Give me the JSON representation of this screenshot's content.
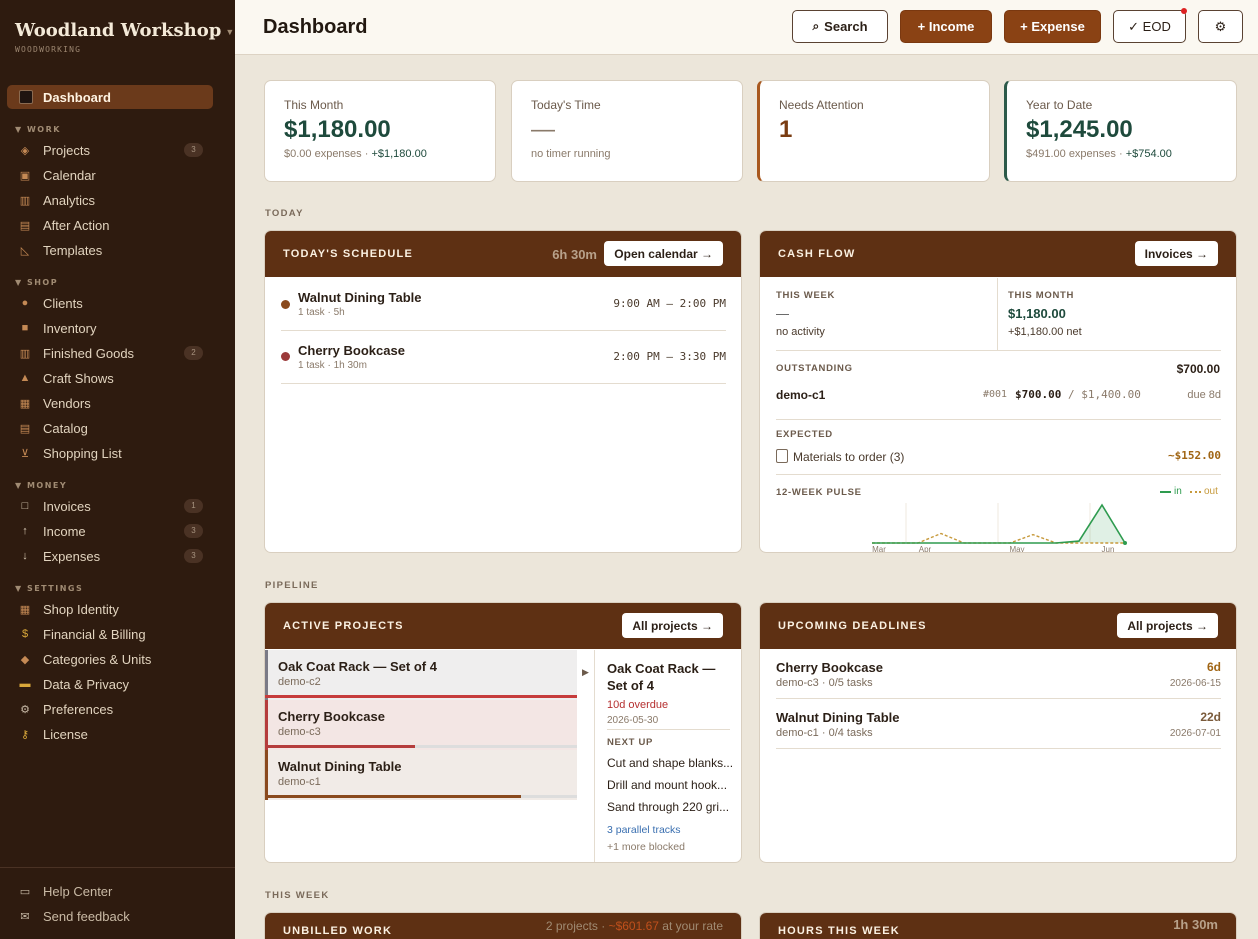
{
  "sidebar": {
    "brand": "Woodland Workshop",
    "brand_sub": "WOODWORKING",
    "active": "Dashboard",
    "sections": {
      "work": "▼ WORK",
      "shop": "▼ SHOP",
      "money": "▼ MONEY",
      "settings": "▼ SETTINGS"
    },
    "work": [
      {
        "label": "Projects",
        "count": "3",
        "icon": "diamond-icon"
      },
      {
        "label": "Calendar",
        "icon": "calendar-icon"
      },
      {
        "label": "Analytics",
        "icon": "bar-chart-icon"
      },
      {
        "label": "After Action",
        "icon": "clipboard-icon"
      },
      {
        "label": "Templates",
        "icon": "ruler-icon"
      }
    ],
    "shop": [
      {
        "label": "Clients",
        "icon": "person-icon"
      },
      {
        "label": "Inventory",
        "icon": "box-icon"
      },
      {
        "label": "Finished Goods",
        "count": "2",
        "icon": "books-icon"
      },
      {
        "label": "Craft Shows",
        "icon": "tent-icon"
      },
      {
        "label": "Vendors",
        "icon": "store-icon"
      },
      {
        "label": "Catalog",
        "icon": "clipboard-icon"
      },
      {
        "label": "Shopping List",
        "icon": "cart-icon"
      }
    ],
    "money": [
      {
        "label": "Invoices",
        "count": "1",
        "icon": "square-icon"
      },
      {
        "label": "Income",
        "count": "3",
        "icon": "arrow-up-icon"
      },
      {
        "label": "Expenses",
        "count": "3",
        "icon": "arrow-down-icon"
      }
    ],
    "settings": [
      {
        "label": "Shop Identity",
        "icon": "store-icon"
      },
      {
        "label": "Financial & Billing",
        "icon": "money-bag-icon"
      },
      {
        "label": "Categories & Units",
        "icon": "tag-icon"
      },
      {
        "label": "Data & Privacy",
        "icon": "lock-icon"
      },
      {
        "label": "Preferences",
        "icon": "gear-icon"
      },
      {
        "label": "License",
        "icon": "key-icon"
      }
    ],
    "footer": [
      {
        "label": "Help Center",
        "icon": "book-icon"
      },
      {
        "label": "Send feedback",
        "icon": "mail-icon"
      }
    ]
  },
  "topbar": {
    "title": "Dashboard",
    "search": "Search",
    "income": "+ Income",
    "expense": "+ Expense",
    "eod": "✓ EOD",
    "settings_icon": "⚙"
  },
  "kpis": [
    {
      "label": "This Month",
      "value": "$1,180.00",
      "sub_a": "$0.00 expenses · ",
      "sub_b": "+$1,180.00"
    },
    {
      "label": "Today's Time",
      "value": "—",
      "sub_a": "no timer running"
    },
    {
      "label": "Needs Attention",
      "value": "1"
    },
    {
      "label": "Year to Date",
      "value": "$1,245.00",
      "sub_a": "$491.00 expenses · ",
      "sub_b": "+$754.00"
    }
  ],
  "sections": {
    "today": "TODAY",
    "pipeline": "PIPELINE",
    "this_week": "THIS WEEK"
  },
  "schedule": {
    "title": "TODAY'S SCHEDULE",
    "total": "6h 30m",
    "button": "Open calendar →",
    "items": [
      {
        "name": "Walnut Dining Table",
        "meta": "1 task · 5h",
        "time": "9:00 AM – 2:00 PM",
        "color": "#8a4a1e"
      },
      {
        "name": "Cherry Bookcase",
        "meta": "1 task · 1h 30m",
        "time": "2:00 PM – 3:30 PM",
        "color": "#9b3a3a"
      }
    ]
  },
  "cashflow": {
    "title": "CASH FLOW",
    "button": "Invoices →",
    "week_label": "THIS WEEK",
    "week_value": "—",
    "week_sub": "no activity",
    "month_label": "THIS MONTH",
    "month_value": "$1,180.00",
    "month_sub": "+$1,180.00 net",
    "outstanding_label": "OUTSTANDING",
    "outstanding_total": "$700.00",
    "outstanding_client": "demo-c1",
    "outstanding_no": "#001",
    "outstanding_paid": "$700.00",
    "outstanding_of": " / $1,400.00",
    "outstanding_due": "due 8d",
    "expected_label": "EXPECTED",
    "expected_item": "Materials to order (3)",
    "expected_value": "~$152.00",
    "pulse_label": "12-WEEK PULSE",
    "legend_in": "in",
    "legend_out": "out"
  },
  "chart_data": {
    "type": "line",
    "x_labels": [
      "Mar",
      "Apr",
      "May",
      "Jun"
    ],
    "series": [
      {
        "name": "in",
        "values": [
          0,
          0,
          0,
          0,
          0,
          0,
          0,
          0,
          0,
          0.05,
          1,
          0
        ],
        "color": "#2e9b4f"
      },
      {
        "name": "out",
        "values": [
          0,
          0,
          0,
          0.25,
          0,
          0,
          0,
          0.22,
          0,
          0,
          0,
          0
        ],
        "color": "#c79a3c"
      }
    ],
    "grid": false,
    "legend": "top-right"
  },
  "projects": {
    "title": "ACTIVE PROJECTS",
    "button": "All projects →",
    "items": [
      {
        "name": "Oak Coat Rack — Set of 4",
        "code": "demo-c2",
        "progress": 1.0
      },
      {
        "name": "Cherry Bookcase",
        "code": "demo-c3",
        "progress": 0.48
      },
      {
        "name": "Walnut Dining Table",
        "code": "demo-c1",
        "progress": 0.82
      }
    ],
    "detail": {
      "title": "Oak Coat Rack — Set of 4",
      "overdue": "10d overdue",
      "date": "2026-05-30",
      "next_label": "NEXT UP",
      "next": [
        "Cut and shape blanks...",
        "Drill and mount hook...",
        "Sand through 220 gri..."
      ],
      "tracks": "3 parallel tracks",
      "blocked": "+1 more blocked"
    }
  },
  "deadlines": {
    "title": "UPCOMING DEADLINES",
    "button": "All projects →",
    "items": [
      {
        "name": "Cherry Bookcase",
        "meta": "demo-c3 · 0/5 tasks",
        "days": "6d",
        "date": "2026-06-15"
      },
      {
        "name": "Walnut Dining Table",
        "meta": "demo-c1 · 0/4 tasks",
        "days": "22d",
        "date": "2026-07-01"
      }
    ]
  },
  "unbilled": {
    "title": "UNBILLED WORK",
    "meta_a": "2 projects · ",
    "meta_b": "~$601.67",
    "meta_c": " at your rate"
  },
  "hours": {
    "title": "HOURS THIS WEEK",
    "total": "1h 30m"
  },
  "colors": {
    "sidebar": "#2e1b0f",
    "accent": "#8a4214",
    "panel_head": "#5e3013",
    "money": "#1e4a3c"
  }
}
